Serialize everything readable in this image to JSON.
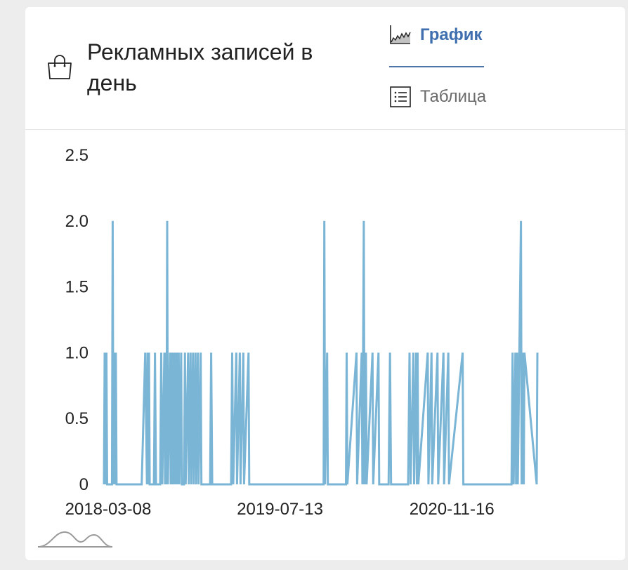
{
  "widget": {
    "title": "Рекламных записей в день",
    "bag_icon": "shopping-bag-icon"
  },
  "tabs": [
    {
      "label": "График",
      "icon": "area-chart-icon",
      "active": true
    },
    {
      "label": "Таблица",
      "icon": "list-table-icon",
      "active": false
    }
  ],
  "colors": {
    "accent": "#3f6fae",
    "series": "#7ab5d6",
    "axis_text": "#222222"
  },
  "chart_data": {
    "type": "line",
    "x_start": "2018-02-24",
    "x_end": "2022-01-08",
    "ylim": [
      0,
      2.5
    ],
    "y_ticks": [
      "0",
      "0.5",
      "1.0",
      "1.5",
      "2.0",
      "2.5"
    ],
    "x_tick_labels": [
      {
        "date": "2018-03-08",
        "label": "2018-03-08"
      },
      {
        "date": "2019-07-13",
        "label": "2019-07-13"
      },
      {
        "date": "2020-11-16",
        "label": "2020-11-16"
      }
    ],
    "grid": false,
    "series": [
      {
        "color": "#7ab5d6",
        "points": [
          [
            "2018-02-24",
            0
          ],
          [
            "2018-02-26",
            1
          ],
          [
            "2018-02-28",
            0
          ],
          [
            "2018-03-03",
            1
          ],
          [
            "2018-03-05",
            0
          ],
          [
            "2018-03-19",
            0
          ],
          [
            "2018-03-21",
            2
          ],
          [
            "2018-03-23",
            0
          ],
          [
            "2018-03-25",
            1
          ],
          [
            "2018-03-27",
            0
          ],
          [
            "2018-03-30",
            1
          ],
          [
            "2018-04-01",
            0
          ],
          [
            "2018-06-12",
            0
          ],
          [
            "2018-06-22",
            1
          ],
          [
            "2018-06-27",
            0
          ],
          [
            "2018-06-29",
            1
          ],
          [
            "2018-07-01",
            0
          ],
          [
            "2018-07-03",
            1
          ],
          [
            "2018-07-05",
            0
          ],
          [
            "2018-07-17",
            0
          ],
          [
            "2018-07-20",
            1
          ],
          [
            "2018-07-23",
            0
          ],
          [
            "2018-08-04",
            0
          ],
          [
            "2018-08-07",
            1
          ],
          [
            "2018-08-10",
            0
          ],
          [
            "2018-08-16",
            1
          ],
          [
            "2018-08-18",
            0
          ],
          [
            "2018-08-20",
            1
          ],
          [
            "2018-08-22",
            0
          ],
          [
            "2018-08-24",
            2
          ],
          [
            "2018-08-26",
            0
          ],
          [
            "2018-09-01",
            1
          ],
          [
            "2018-09-03",
            0
          ],
          [
            "2018-09-07",
            1
          ],
          [
            "2018-09-09",
            0
          ],
          [
            "2018-09-11",
            1
          ],
          [
            "2018-09-13",
            0
          ],
          [
            "2018-09-16",
            1
          ],
          [
            "2018-09-18",
            0
          ],
          [
            "2018-09-21",
            1
          ],
          [
            "2018-09-23",
            0
          ],
          [
            "2018-09-26",
            1
          ],
          [
            "2018-09-28",
            0
          ],
          [
            "2018-10-03",
            1
          ],
          [
            "2018-10-05",
            0
          ],
          [
            "2018-10-11",
            0
          ],
          [
            "2018-10-14",
            1
          ],
          [
            "2018-10-16",
            0
          ],
          [
            "2018-10-23",
            1
          ],
          [
            "2018-10-25",
            0
          ],
          [
            "2018-10-30",
            1
          ],
          [
            "2018-11-01",
            0
          ],
          [
            "2018-11-06",
            1
          ],
          [
            "2018-11-08",
            0
          ],
          [
            "2018-11-13",
            1
          ],
          [
            "2018-11-15",
            0
          ],
          [
            "2018-11-20",
            1
          ],
          [
            "2018-11-22",
            0
          ],
          [
            "2018-11-28",
            1
          ],
          [
            "2018-11-30",
            0
          ],
          [
            "2018-12-25",
            0
          ],
          [
            "2018-12-28",
            1
          ],
          [
            "2018-12-31",
            0
          ],
          [
            "2019-02-23",
            0
          ],
          [
            "2019-02-26",
            1
          ],
          [
            "2019-03-01",
            0
          ],
          [
            "2019-03-10",
            1
          ],
          [
            "2019-03-12",
            0
          ],
          [
            "2019-03-20",
            1
          ],
          [
            "2019-03-22",
            0
          ],
          [
            "2019-03-30",
            1
          ],
          [
            "2019-04-01",
            0
          ],
          [
            "2019-04-14",
            1
          ],
          [
            "2019-04-16",
            0
          ],
          [
            "2019-11-15",
            0
          ],
          [
            "2019-11-17",
            2
          ],
          [
            "2019-11-19",
            0
          ],
          [
            "2019-11-25",
            1
          ],
          [
            "2019-11-27",
            0
          ],
          [
            "2020-01-18",
            0
          ],
          [
            "2020-01-20",
            1
          ],
          [
            "2020-01-22",
            0
          ],
          [
            "2020-02-17",
            1
          ],
          [
            "2020-02-19",
            0
          ],
          [
            "2020-03-03",
            1
          ],
          [
            "2020-03-05",
            0
          ],
          [
            "2020-03-09",
            2
          ],
          [
            "2020-03-11",
            0
          ],
          [
            "2020-03-15",
            1
          ],
          [
            "2020-03-17",
            0
          ],
          [
            "2020-04-03",
            1
          ],
          [
            "2020-04-05",
            0
          ],
          [
            "2020-04-20",
            1
          ],
          [
            "2020-04-22",
            0
          ],
          [
            "2020-05-19",
            0
          ],
          [
            "2020-05-23",
            1
          ],
          [
            "2020-05-26",
            0
          ],
          [
            "2020-07-14",
            0
          ],
          [
            "2020-07-18",
            1
          ],
          [
            "2020-07-21",
            0
          ],
          [
            "2020-07-29",
            1
          ],
          [
            "2020-07-31",
            0
          ],
          [
            "2020-08-06",
            1
          ],
          [
            "2020-08-08",
            0
          ],
          [
            "2020-08-10",
            1
          ],
          [
            "2020-08-12",
            0
          ],
          [
            "2020-09-08",
            1
          ],
          [
            "2020-09-10",
            0
          ],
          [
            "2020-09-19",
            1
          ],
          [
            "2020-09-21",
            0
          ],
          [
            "2020-10-06",
            1
          ],
          [
            "2020-10-08",
            0
          ],
          [
            "2020-10-23",
            1
          ],
          [
            "2020-10-25",
            0
          ],
          [
            "2020-11-06",
            1
          ],
          [
            "2020-11-08",
            0
          ],
          [
            "2020-12-17",
            1
          ],
          [
            "2020-12-19",
            0
          ],
          [
            "2021-05-06",
            0
          ],
          [
            "2021-05-09",
            1
          ],
          [
            "2021-05-12",
            0
          ],
          [
            "2021-05-17",
            1
          ],
          [
            "2021-05-19",
            0
          ],
          [
            "2021-05-22",
            1
          ],
          [
            "2021-05-24",
            0
          ],
          [
            "2021-06-02",
            2
          ],
          [
            "2021-06-04",
            0
          ],
          [
            "2021-06-08",
            1
          ],
          [
            "2021-06-10",
            0
          ],
          [
            "2021-06-12",
            1
          ],
          [
            "2021-07-17",
            0
          ],
          [
            "2021-07-19",
            1
          ]
        ]
      }
    ]
  },
  "brush_icon": "range-brush-icon"
}
